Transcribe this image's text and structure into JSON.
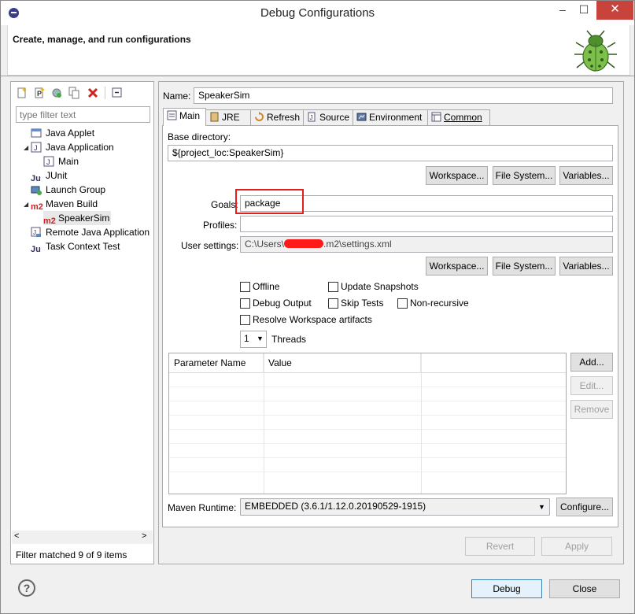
{
  "window": {
    "title": "Debug Configurations",
    "minimize": "–",
    "maximize": "☐",
    "close": "✕"
  },
  "header": {
    "title": "Create, manage, and run configurations"
  },
  "left": {
    "filter_placeholder": "type filter text",
    "tree": [
      {
        "label": "Java Applet",
        "icon": "java-applet-icon"
      },
      {
        "label": "Java Application",
        "icon": "java-application-icon",
        "expanded": true
      },
      {
        "label": "Main",
        "icon": "java-class-icon"
      },
      {
        "label": "JUnit",
        "icon": "junit-icon"
      },
      {
        "label": "Launch Group",
        "icon": "launch-group-icon"
      },
      {
        "label": "Maven Build",
        "icon": "maven-icon",
        "expanded": true
      },
      {
        "label": "SpeakerSim",
        "icon": "maven-icon",
        "selected": true
      },
      {
        "label": "Remote Java Application",
        "icon": "remote-java-icon"
      },
      {
        "label": "Task Context Test",
        "icon": "task-context-icon"
      }
    ],
    "status": "Filter matched 9 of 9 items",
    "scroll_left": "<",
    "scroll_right": ">"
  },
  "right": {
    "name_label": "Name:",
    "name_value": "SpeakerSim",
    "tabs": [
      "Main",
      "JRE",
      "Refresh",
      "Source",
      "Environment",
      "Common"
    ],
    "base_dir_label": "Base directory:",
    "base_dir_value": "${project_loc:SpeakerSim}",
    "workspace_btn": "Workspace...",
    "filesystem_btn": "File System...",
    "variables_btn": "Variables...",
    "goals_label": "Goals:",
    "goals_value": "package",
    "profiles_label": "Profiles:",
    "profiles_value": "",
    "user_settings_label": "User settings:",
    "user_settings_prefix": "C:\\Users\\",
    "user_settings_suffix": ".m2\\settings.xml",
    "checkboxes": {
      "offline": "Offline",
      "update_snapshots": "Update Snapshots",
      "debug_output": "Debug Output",
      "skip_tests": "Skip Tests",
      "non_recursive": "Non-recursive",
      "resolve_workspace": "Resolve Workspace artifacts"
    },
    "threads_value": "1",
    "threads_label": "Threads",
    "table": {
      "col1": "Parameter Name",
      "col2": "Value"
    },
    "add_btn": "Add...",
    "edit_btn": "Edit...",
    "remove_btn": "Remove",
    "runtime_label": "Maven Runtime:",
    "runtime_value": "EMBEDDED (3.6.1/1.12.0.20190529-1915)",
    "configure_btn": "Configure...",
    "revert_btn": "Revert",
    "apply_btn": "Apply"
  },
  "footer": {
    "help": "?",
    "debug_btn": "Debug",
    "close_btn": "Close"
  },
  "colors": {
    "highlight_box": "#e02020",
    "maven_red": "#d02020",
    "accent_blue": "#3c7fb1"
  }
}
